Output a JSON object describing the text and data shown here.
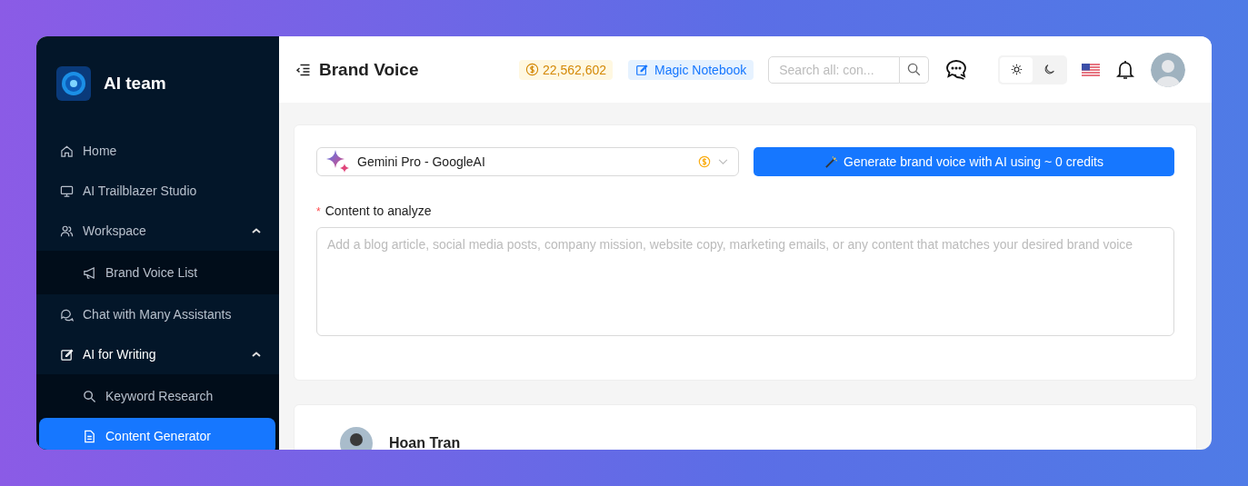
{
  "brand": {
    "name": "AI team"
  },
  "sidebar": {
    "items": [
      {
        "label": "Home"
      },
      {
        "label": "AI Trailblazer Studio"
      },
      {
        "label": "Workspace",
        "expanded": true,
        "children": [
          {
            "label": "Brand Voice List",
            "selected": false
          }
        ]
      },
      {
        "label": "Chat with Many Assistants"
      },
      {
        "label": "AI for Writing",
        "expanded": true,
        "children": [
          {
            "label": "Keyword Research",
            "selected": false
          },
          {
            "label": "Content Generator",
            "selected": true
          }
        ]
      }
    ]
  },
  "header": {
    "title": "Brand Voice",
    "credits": "22,562,602",
    "notebook": "Magic Notebook",
    "search": {
      "placeholder": "Search all: con..."
    },
    "theme_toggle": [
      {
        "kind": "light",
        "selected": true
      },
      {
        "kind": "dark",
        "selected": false
      }
    ]
  },
  "form": {
    "model": "Gemini Pro - GoogleAI",
    "generate_button": "Generate brand voice with AI using ~ 0 credits",
    "content_label": "Content to analyze",
    "required_mark": "*",
    "content_placeholder": "Add a blog article, social media posts, company mission, website copy, marketing emails, or any content that matches your desired brand voice"
  },
  "result": {
    "author": "Hoan Tran"
  }
}
